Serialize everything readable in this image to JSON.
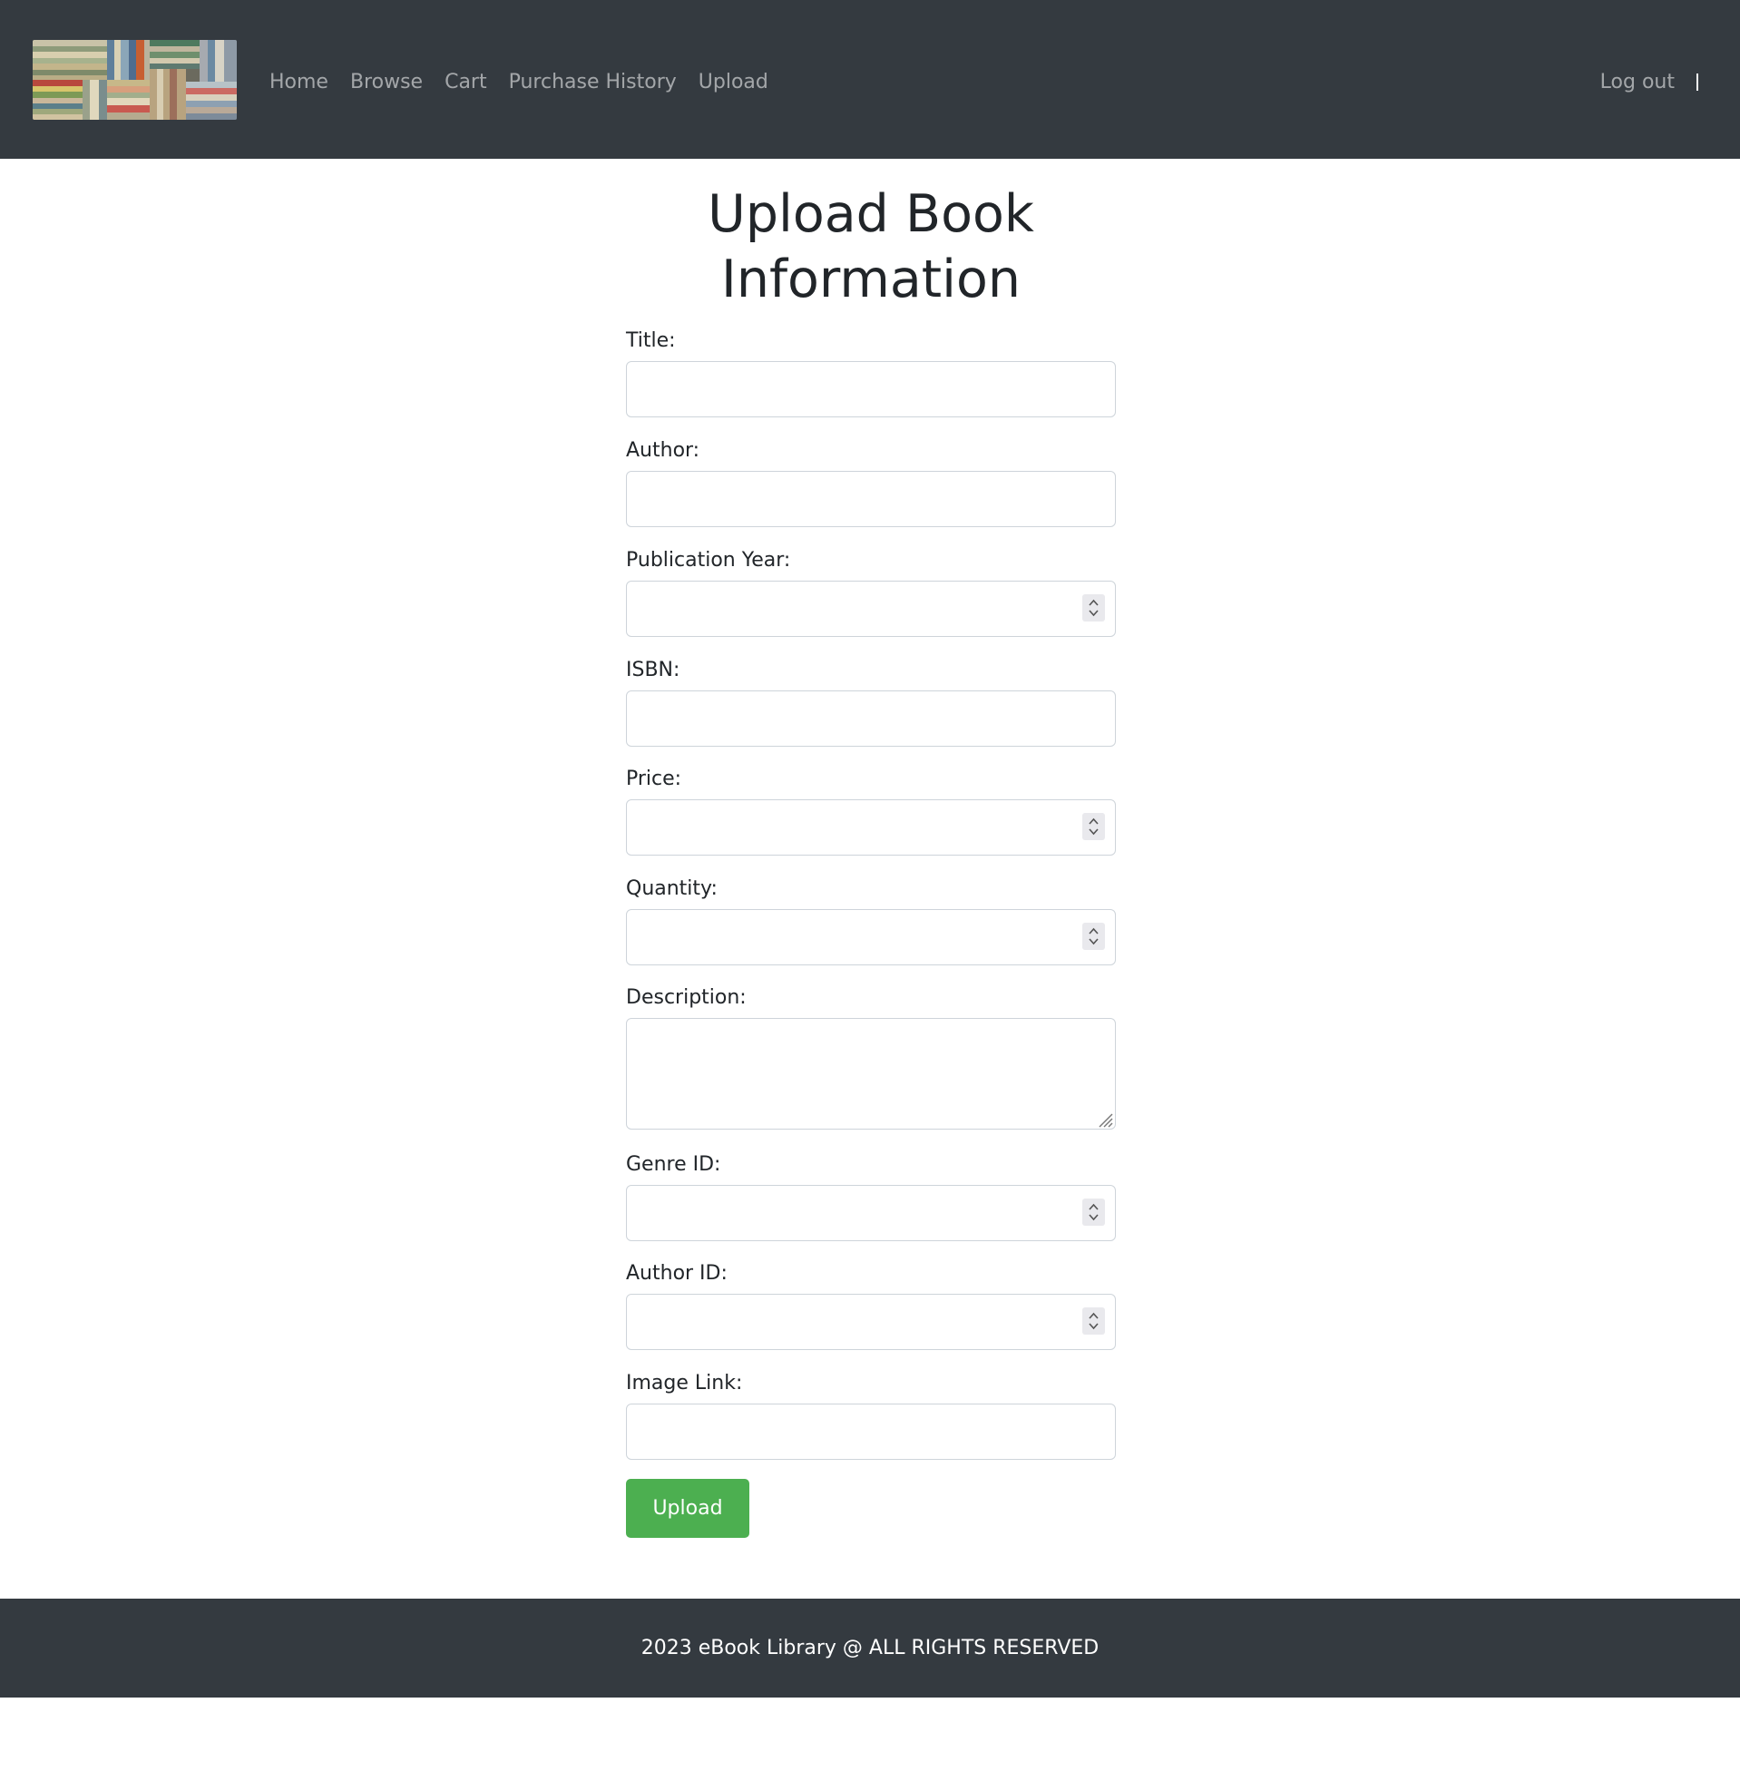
{
  "nav": {
    "logo_icon": "bookshelf-logo-image",
    "links": [
      "Home",
      "Browse",
      "Cart",
      "Purchase History",
      "Upload"
    ],
    "logout": "Log out"
  },
  "form": {
    "title": "Upload Book Information",
    "fields": {
      "title": {
        "label": "Title:",
        "value": "",
        "type": "text"
      },
      "author": {
        "label": "Author:",
        "value": "",
        "type": "text"
      },
      "publication_year": {
        "label": "Publication Year:",
        "value": "",
        "type": "number"
      },
      "isbn": {
        "label": "ISBN:",
        "value": "",
        "type": "text"
      },
      "price": {
        "label": "Price:",
        "value": "",
        "type": "number"
      },
      "quantity": {
        "label": "Quantity:",
        "value": "",
        "type": "number"
      },
      "description": {
        "label": "Description:",
        "value": "",
        "type": "textarea"
      },
      "genre_id": {
        "label": "Genre ID:",
        "value": "",
        "type": "number"
      },
      "author_id": {
        "label": "Author ID:",
        "value": "",
        "type": "number"
      },
      "image_link": {
        "label": "Image Link:",
        "value": "",
        "type": "text"
      }
    },
    "submit_label": "Upload",
    "submit_color": "#4caf50"
  },
  "footer": {
    "text": "2023 eBook Library @ ALL RIGHTS RESERVED"
  },
  "colors": {
    "navbar_bg": "#343a40",
    "footer_bg": "#343a40",
    "nav_link": "#a1a4a7"
  }
}
